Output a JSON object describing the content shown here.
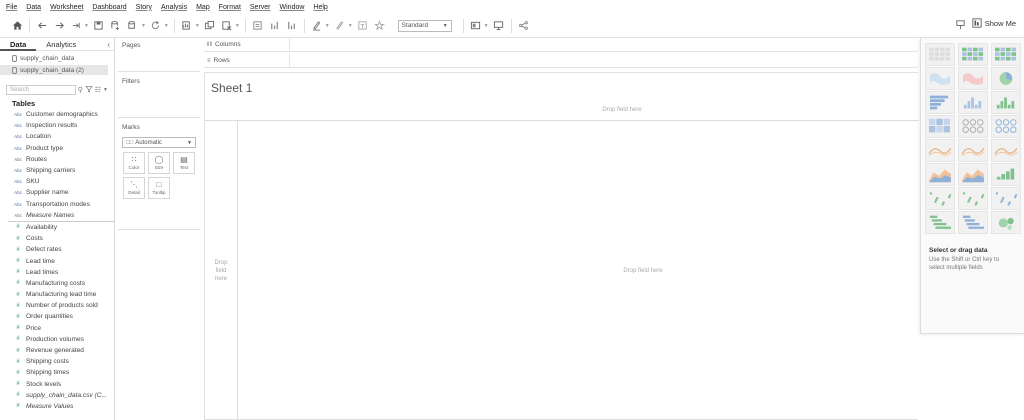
{
  "menu": [
    "File",
    "Data",
    "Worksheet",
    "Dashboard",
    "Story",
    "Analysis",
    "Map",
    "Format",
    "Server",
    "Window",
    "Help"
  ],
  "toolbar": {
    "icons": [
      "home-icon",
      "undo-icon",
      "redo-icon",
      "replay-icon",
      "save-icon",
      "add-datasource-icon",
      "pause-icon",
      "refresh-icon",
      "chart-type-icon",
      "duplicate-sheet-icon",
      "clear-sheet-icon",
      "swap-icon",
      "sort-asc-icon",
      "sort-desc-icon",
      "highlight-icon",
      "group-icon",
      "labels-icon",
      "fix-axes-icon",
      "fit-icon",
      "presentation-icon",
      "share-icon"
    ],
    "fit_value": "Standard",
    "show_me_label": "Show Me"
  },
  "datapane": {
    "tabs": [
      "Data",
      "Analytics"
    ],
    "sources": [
      "supply_chain_data",
      "supply_chain_data (2)"
    ],
    "search_placeholder": "Search",
    "tables_label": "Tables",
    "dimensions": [
      {
        "type": "Abc",
        "name": "Customer demographics"
      },
      {
        "type": "Abc",
        "name": "Inspection results"
      },
      {
        "type": "Abc",
        "name": "Location"
      },
      {
        "type": "Abc",
        "name": "Product type"
      },
      {
        "type": "Abc",
        "name": "Routes"
      },
      {
        "type": "Abc",
        "name": "Shipping carriers"
      },
      {
        "type": "Abc",
        "name": "SKU"
      },
      {
        "type": "Abc",
        "name": "Supplier name"
      },
      {
        "type": "Abc",
        "name": "Transportation modes"
      },
      {
        "type": "Abc",
        "name": "Measure Names",
        "italic": true
      }
    ],
    "measures": [
      {
        "type": "#",
        "name": "Availability"
      },
      {
        "type": "#",
        "name": "Costs"
      },
      {
        "type": "#",
        "name": "Defect rates"
      },
      {
        "type": "#",
        "name": "Lead time"
      },
      {
        "type": "#",
        "name": "Lead times"
      },
      {
        "type": "#",
        "name": "Manufacturing costs"
      },
      {
        "type": "#",
        "name": "Manufacturing lead time"
      },
      {
        "type": "#",
        "name": "Number of products sold"
      },
      {
        "type": "#",
        "name": "Order quantities"
      },
      {
        "type": "#",
        "name": "Price"
      },
      {
        "type": "#",
        "name": "Production volumes"
      },
      {
        "type": "#",
        "name": "Revenue generated"
      },
      {
        "type": "#",
        "name": "Shipping costs"
      },
      {
        "type": "#",
        "name": "Shipping times"
      },
      {
        "type": "#",
        "name": "Stock levels"
      },
      {
        "type": "#",
        "name": "supply_chain_data.csv (C...",
        "italic": true
      },
      {
        "type": "#",
        "name": "Measure Values",
        "italic": true
      }
    ]
  },
  "shelves": {
    "pages_label": "Pages",
    "filters_label": "Filters",
    "marks_label": "Marks",
    "marks_type": "Automatic",
    "marks_cards": [
      "Color",
      "Size",
      "Text",
      "Detail",
      "Tooltip"
    ],
    "columns_label": "Columns",
    "rows_label": "Rows"
  },
  "sheet": {
    "title": "Sheet 1",
    "drop_top": "Drop field here",
    "drop_left": "Drop field here",
    "drop_main": "Drop field here"
  },
  "showme_panel": {
    "hint_title": "Select or drag data",
    "hint_text": "Use the Shift or Ctrl key to select multiple fields"
  },
  "colors": {
    "dimension_icon": "#4b6ea0",
    "measure_icon": "#2f9b6a",
    "selected_source_bg": "#e6e6e6"
  }
}
